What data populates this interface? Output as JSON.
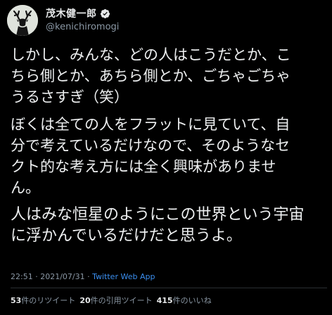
{
  "author": {
    "display_name": "茂木健一郎",
    "handle": "@kenichiromogi",
    "verified_icon": "verified-badge-icon",
    "avatar_icon": "deer-avatar"
  },
  "tweet": {
    "paragraphs": [
      {
        "lines": [
          "しかし、みんな、どの人はこうだとか、こ",
          "ちら側とか、あちら側とか、ごちゃごちゃ",
          "うるさすぎ（笑）"
        ]
      },
      {
        "lines": [
          "ぼくは全ての人をフラットに見ていて、自",
          "分で考えているだけなので、そのようなセ",
          "クト的な考え方には全く興味がありませ",
          "ん。"
        ]
      },
      {
        "lines": [
          "人はみな恒星のようにこの世界という宇宙",
          "に浮かんでいるだけだと思うよ。"
        ]
      }
    ]
  },
  "meta": {
    "time": "22:51",
    "date": "2021/07/31",
    "separator": "·",
    "source": "Twitter Web App"
  },
  "stats": {
    "retweets": {
      "count": "53",
      "label": "件のリツイート"
    },
    "quotes": {
      "count": "20",
      "label": "件の引用ツイート"
    },
    "likes": {
      "count": "415",
      "label": "件のいいね"
    }
  },
  "colors": {
    "background": "#000000",
    "text": "#e7e9ea",
    "secondary": "#8b98a5",
    "link": "#3b8ff0",
    "verified": "#1d9bf0"
  }
}
